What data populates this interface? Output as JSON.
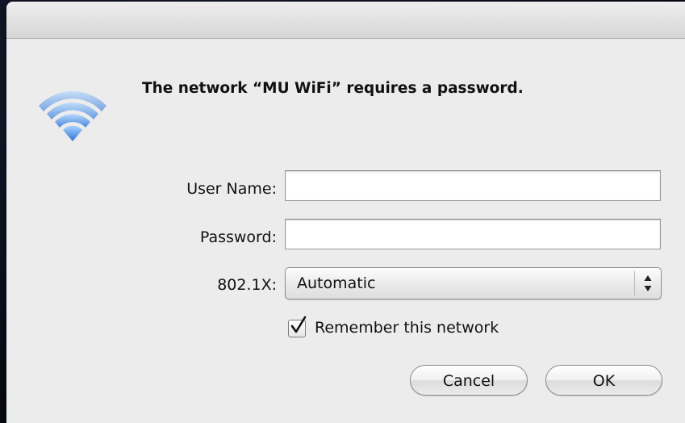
{
  "dialog": {
    "message": "The network “MU WiFi” requires a password.",
    "icon": "wifi-icon"
  },
  "form": {
    "username_label": "User Name:",
    "username_value": "",
    "password_label": "Password:",
    "password_value": "",
    "security_label": "802.1X:",
    "security_value": "Automatic",
    "remember_label": "Remember this network",
    "remember_checked": true
  },
  "buttons": {
    "cancel_label": "Cancel",
    "ok_label": "OK"
  },
  "colors": {
    "wifi_blue": "#4a8fe0",
    "dialog_bg": "#ececec"
  }
}
